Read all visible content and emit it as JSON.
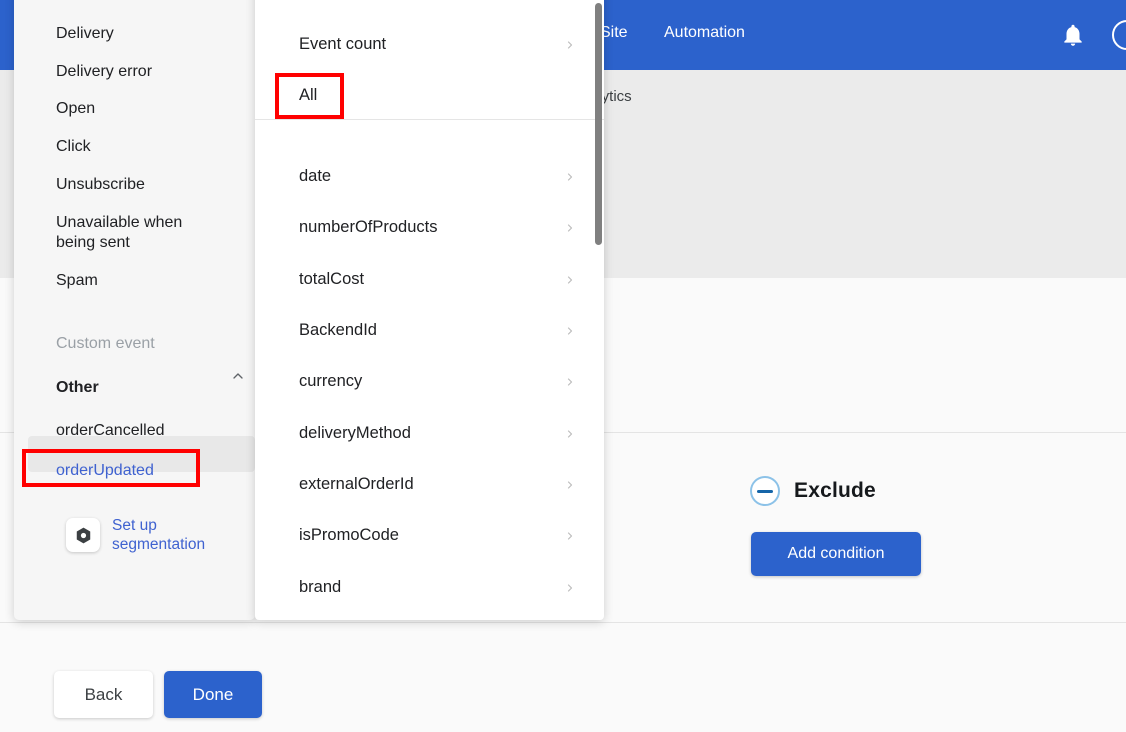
{
  "header": {
    "nav": [
      {
        "label": "Site",
        "name": "nav-site"
      },
      {
        "label": "Automation",
        "name": "nav-automation"
      }
    ],
    "bell_icon": "bell-icon",
    "avatar_icon": "avatar",
    "accent_color": "#2c62cc"
  },
  "breadcrumb": {
    "text": "alytics"
  },
  "exclude_section": {
    "icon": "minus-circle-icon",
    "label": "Exclude",
    "add_condition_label": "Add condition",
    "icon_color": "#8cc2e8",
    "button_color": "#2c62cc"
  },
  "footer": {
    "back_label": "Back",
    "done_label": "Done"
  },
  "event_panel": {
    "items": [
      {
        "label": "Delivery"
      },
      {
        "label": "Delivery error"
      },
      {
        "label": "Open"
      },
      {
        "label": "Click"
      },
      {
        "label": "Unsubscribe"
      },
      {
        "label": "Unavailable when being sent"
      },
      {
        "label": "Spam"
      }
    ],
    "custom_event_label": "Custom event",
    "other_label": "Other",
    "other_collapse_icon": "chevron-up-icon",
    "other_items": [
      {
        "label": "orderCancelled",
        "selected": false
      },
      {
        "label": "orderUpdated",
        "selected": true
      }
    ],
    "segmentation": {
      "icon": "gear-hexagon-icon",
      "label": "Set up segmentation",
      "link_color": "#3f62d0"
    },
    "scrollbar": "vertical-scrollbar"
  },
  "property_panel": {
    "top_items": [
      {
        "label": "Event count",
        "chevron": "chevron-right-icon"
      },
      {
        "label": "All",
        "chevron": null,
        "highlighted": true
      }
    ],
    "properties": [
      {
        "label": "date",
        "chevron": "chevron-right-icon"
      },
      {
        "label": "numberOfProducts",
        "chevron": "chevron-right-icon"
      },
      {
        "label": "totalCost",
        "chevron": "chevron-right-icon"
      },
      {
        "label": "BackendId",
        "chevron": "chevron-right-icon"
      },
      {
        "label": "currency",
        "chevron": "chevron-right-icon"
      },
      {
        "label": "deliveryMethod",
        "chevron": "chevron-right-icon"
      },
      {
        "label": "externalOrderId",
        "chevron": "chevron-right-icon"
      },
      {
        "label": "isPromoCode",
        "chevron": "chevron-right-icon"
      },
      {
        "label": "brand",
        "chevron": "chevron-right-icon"
      }
    ],
    "scrollbar": "vertical-scrollbar"
  },
  "annotations": {
    "color": "#ff0000",
    "boxes": [
      {
        "target": "All"
      },
      {
        "target": "orderUpdated"
      }
    ]
  }
}
